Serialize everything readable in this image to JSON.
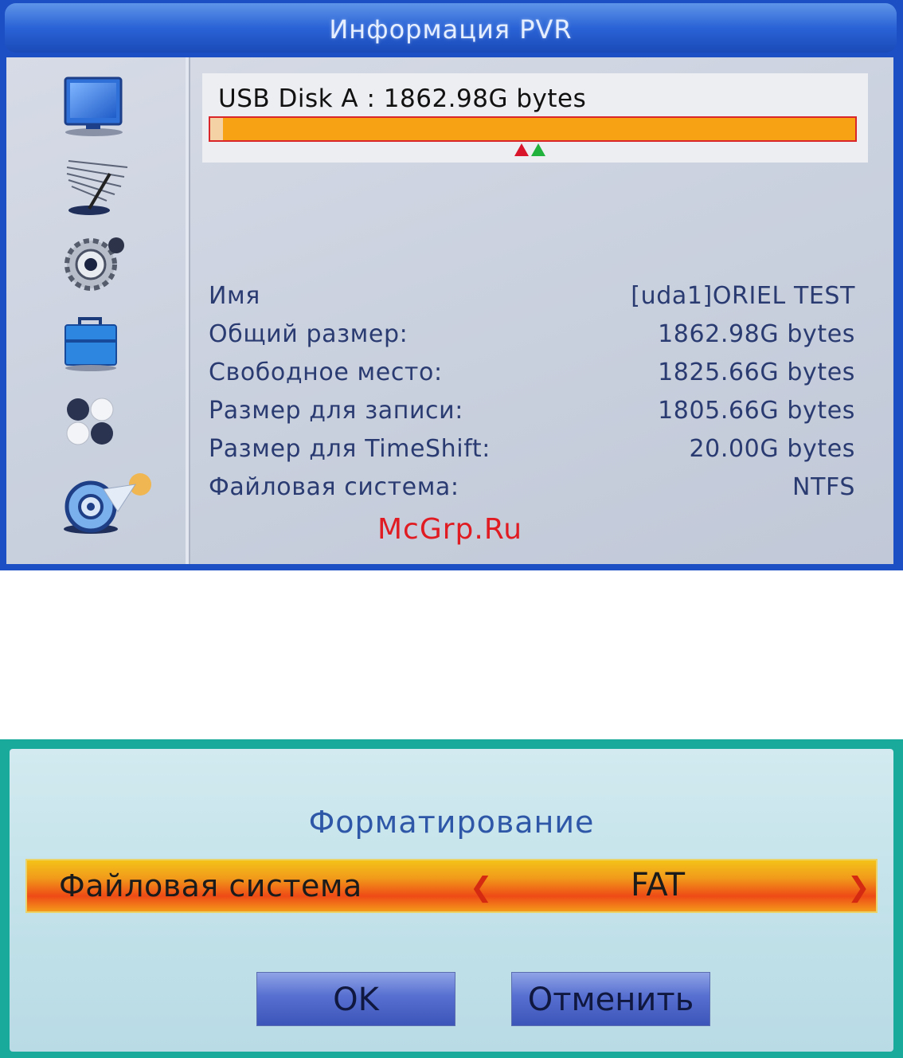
{
  "pvr_info": {
    "title": "Информация PVR",
    "sidebar": [
      {
        "icon": "tv-icon"
      },
      {
        "icon": "satellite-dish-icon"
      },
      {
        "icon": "gear-icon"
      },
      {
        "icon": "toolbox-icon"
      },
      {
        "icon": "balls-icon"
      },
      {
        "icon": "media-disc-icon",
        "selected": true
      }
    ],
    "disk": {
      "label": "USB Disk A : 1862.98G bytes",
      "used_fraction": 0.02,
      "colors": {
        "bar": "#f7a214",
        "border": "#d8262a",
        "used": "#f4d2a6"
      }
    },
    "rows": [
      {
        "label": "Имя",
        "value": "[uda1]ORIEL TEST"
      },
      {
        "label": "Общий размер:",
        "value": "1862.98G bytes"
      },
      {
        "label": "Свободное место:",
        "value": "1825.66G bytes"
      },
      {
        "label": "Размер для записи:",
        "value": "1805.66G bytes"
      },
      {
        "label": "Размер для TimeShift:",
        "value": "20.00G bytes"
      },
      {
        "label": "Файловая система:",
        "value": "NTFS"
      }
    ],
    "watermark": "McGrp.Ru"
  },
  "format_dialog": {
    "title": "Форматирование",
    "field_label": "Файловая система",
    "field_value": "FAT",
    "ok_label": "OK",
    "cancel_label": "Отменить"
  }
}
